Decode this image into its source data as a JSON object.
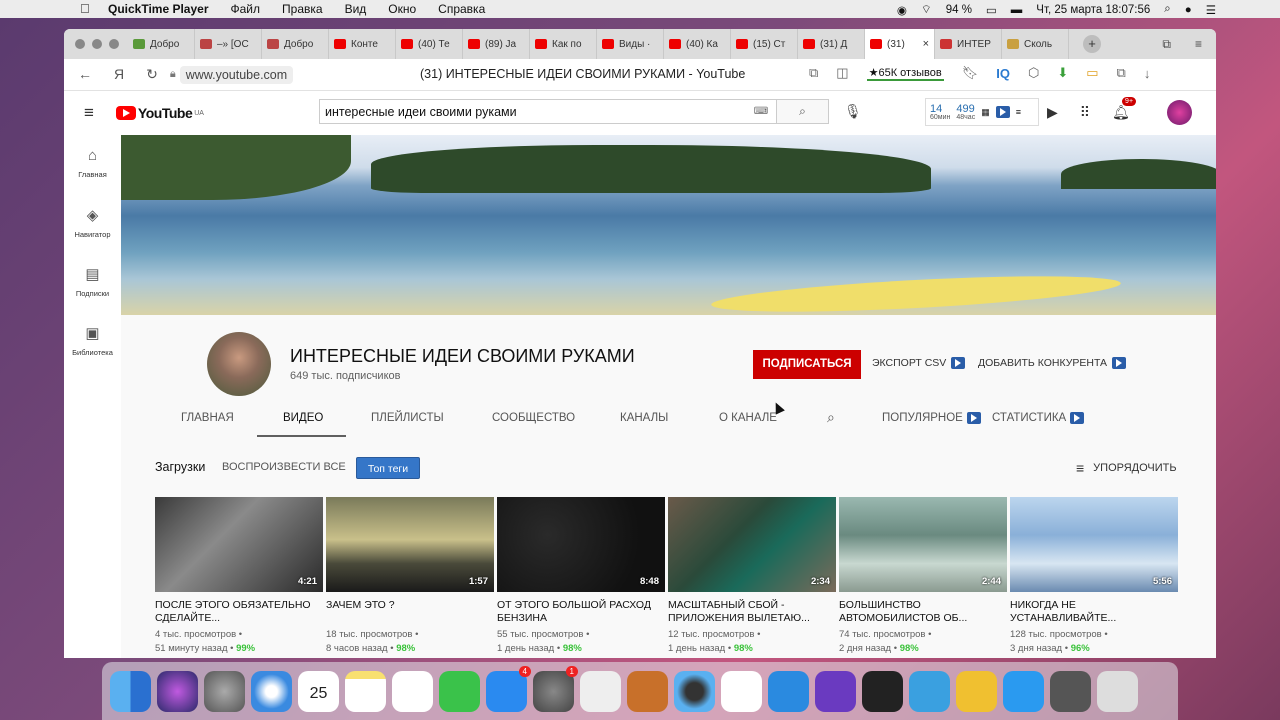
{
  "menubar": {
    "app": "QuickTime Player",
    "menus": [
      "Файл",
      "Правка",
      "Вид",
      "Окно",
      "Справка"
    ],
    "battery": "94 %",
    "datetime": "Чт, 25 марта  18:07:56"
  },
  "tabs": [
    {
      "label": "Добро",
      "color": "#5a9a3a"
    },
    {
      "label": "–» [ОС",
      "color": "#b44"
    },
    {
      "label": "Добро",
      "color": "#b44"
    },
    {
      "label": "Конте",
      "color": "#e00"
    },
    {
      "label": "(40) Те",
      "color": "#e00"
    },
    {
      "label": "(89) Ja",
      "color": "#e00"
    },
    {
      "label": "Как по",
      "color": "#e00"
    },
    {
      "label": "Виды ·",
      "color": "#e00"
    },
    {
      "label": "(40) Ка",
      "color": "#e00"
    },
    {
      "label": "(15) Ст",
      "color": "#e00"
    },
    {
      "label": "(31) Д",
      "color": "#e00"
    },
    {
      "label": "(31)",
      "color": "#e00",
      "active": true
    },
    {
      "label": "ИНТЕР",
      "color": "#c33"
    },
    {
      "label": "Сколь",
      "color": "#c9a040"
    }
  ],
  "address": {
    "url": "www.youtube.com",
    "page_title": "(31) ИНТЕРЕСНЫЕ ИДЕИ СВОИМИ РУКАМИ - YouTube",
    "reviews": "★65К отзывов",
    "iq": "IQ"
  },
  "youtube": {
    "logo": "YouTube",
    "region": "UA",
    "search_value": "интересные идеи своими руками",
    "stats": {
      "a": "14",
      "a_sub": "60мин",
      "b": "499",
      "b_sub": "48час"
    },
    "notif_count": "9+"
  },
  "leftnav": [
    {
      "label": "Главная",
      "icon": "home-icon"
    },
    {
      "label": "Навигатор",
      "icon": "compass-icon"
    },
    {
      "label": "Подписки",
      "icon": "subscriptions-icon"
    },
    {
      "label": "Библиотека",
      "icon": "library-icon"
    }
  ],
  "channel": {
    "name": "ИНТЕРЕСНЫЕ ИДЕИ СВОИМИ РУКАМИ",
    "subscribers": "649 тыс. подписчиков",
    "subscribe": "ПОДПИСАТЬСЯ",
    "export_csv": "ЭКСПОРТ CSV",
    "add_competitor": "ДОБАВИТЬ КОНКУРЕНТА",
    "tabs": [
      "ГЛАВНАЯ",
      "ВИДЕО",
      "ПЛЕЙЛИСТЫ",
      "СООБЩЕСТВО",
      "КАНАЛЫ",
      "О КАНАЛЕ"
    ],
    "popular": "ПОПУЛЯРНОЕ",
    "statistics": "СТАТИСТИКА"
  },
  "filters": {
    "uploads": "Загрузки",
    "play_all": "ВОСПРОИЗВЕСТИ ВСЕ",
    "top_tags": "Топ теги",
    "sort": "УПОРЯДОЧИТЬ"
  },
  "videos": [
    {
      "title": "ПОСЛЕ ЭТОГО ОБЯЗАТЕЛЬНО СДЕЛАЙТЕ...",
      "duration": "4:21",
      "views": "4 тыс. просмотров",
      "age": "51 минуту назад",
      "pct": "99%",
      "bg": "linear-gradient(135deg,#3a3a3a,#8a8a8a 40%,#2a2a2a)"
    },
    {
      "title": "ЗАЧЕМ ЭТО ?",
      "duration": "1:57",
      "views": "18 тыс. просмотров",
      "age": "8 часов назад",
      "pct": "98%",
      "bg": "linear-gradient(180deg,#7a7a5a,#c9c08a 45%,#4a4a3a 70%,#1a1a1a)"
    },
    {
      "title": "ОТ ЭТОГО БОЛЬШОЙ РАСХОД БЕНЗИНА",
      "duration": "8:48",
      "views": "55 тыс. просмотров",
      "age": "1 день назад",
      "pct": "98%",
      "bg": "radial-gradient(circle at 30% 40%,#2a2a2a,#111 70%)"
    },
    {
      "title": "МАСШТАБНЫЙ СБОЙ - ПРИЛОЖЕНИЯ ВЫЛЕТАЮ...",
      "duration": "2:34",
      "views": "12 тыс. просмотров",
      "age": "1 день назад",
      "pct": "98%",
      "bg": "linear-gradient(135deg,#6a5a4a,#2a4a3a 40%,#1a6a5a 60%,#7a6a5a)"
    },
    {
      "title": "БОЛЬШИНСТВО АВТОМОБИЛИСТОВ ОБ...",
      "duration": "2:44",
      "views": "74 тыс. просмотров",
      "age": "2 дня назад",
      "pct": "98%",
      "bg": "linear-gradient(180deg,#9ab8b0,#6a8a80 40%,#c8d8d0 70%,#8a9a90)"
    },
    {
      "title": "НИКОГДА НЕ УСТАНАВЛИВАЙТЕ...",
      "duration": "5:56",
      "views": "128 тыс. просмотров",
      "age": "3 дня назад",
      "pct": "96%",
      "bg": "linear-gradient(180deg,#bcd6ee,#8ab0d8 40%,#d8e6f2 70%,#6a8ab0)"
    }
  ],
  "dock": [
    {
      "name": "finder-icon",
      "color": "linear-gradient(90deg,#5ab0f0 50%,#2a70d0 50%)"
    },
    {
      "name": "siri-icon",
      "color": "radial-gradient(circle,#c05ae0,#2a2a6a)"
    },
    {
      "name": "launchpad-icon",
      "color": "radial-gradient(circle,#aaa,#555)"
    },
    {
      "name": "safari-icon",
      "color": "radial-gradient(circle,#fff 20%,#3a8ae0 60%)"
    },
    {
      "name": "calendar-icon",
      "color": "#fff",
      "text": "25"
    },
    {
      "name": "notes-icon",
      "color": "linear-gradient(180deg,#f8e070 20%,#fff 20%)"
    },
    {
      "name": "reminders-icon",
      "color": "#fff"
    },
    {
      "name": "facetime-icon",
      "color": "#3ac24a"
    },
    {
      "name": "appstore-icon",
      "color": "#2a8af0",
      "badge": "4"
    },
    {
      "name": "system-preferences-icon",
      "color": "radial-gradient(circle,#888,#444)",
      "badge": "1"
    },
    {
      "name": "screenshot-icon",
      "color": "#eee"
    },
    {
      "name": "photobooth-icon",
      "color": "#c8702a"
    },
    {
      "name": "quicktime-icon",
      "color": "radial-gradient(circle,#333 30%,#5ab0f0 60%)"
    },
    {
      "name": "yandex-browser-icon",
      "color": "#fff"
    },
    {
      "name": "vscode-icon",
      "color": "#2a8ae0"
    },
    {
      "name": "imovie-icon",
      "color": "#6a3ac0"
    },
    {
      "name": "final-cut-icon",
      "color": "#222"
    },
    {
      "name": "telegram-icon",
      "color": "#3aa0e0"
    },
    {
      "name": "video-player-icon",
      "color": "#f0c030"
    },
    {
      "name": "skype-icon",
      "color": "#2a9af0"
    },
    {
      "name": "downloads-stack-icon",
      "color": "#555"
    },
    {
      "name": "trash-icon",
      "color": "#ddd"
    }
  ]
}
